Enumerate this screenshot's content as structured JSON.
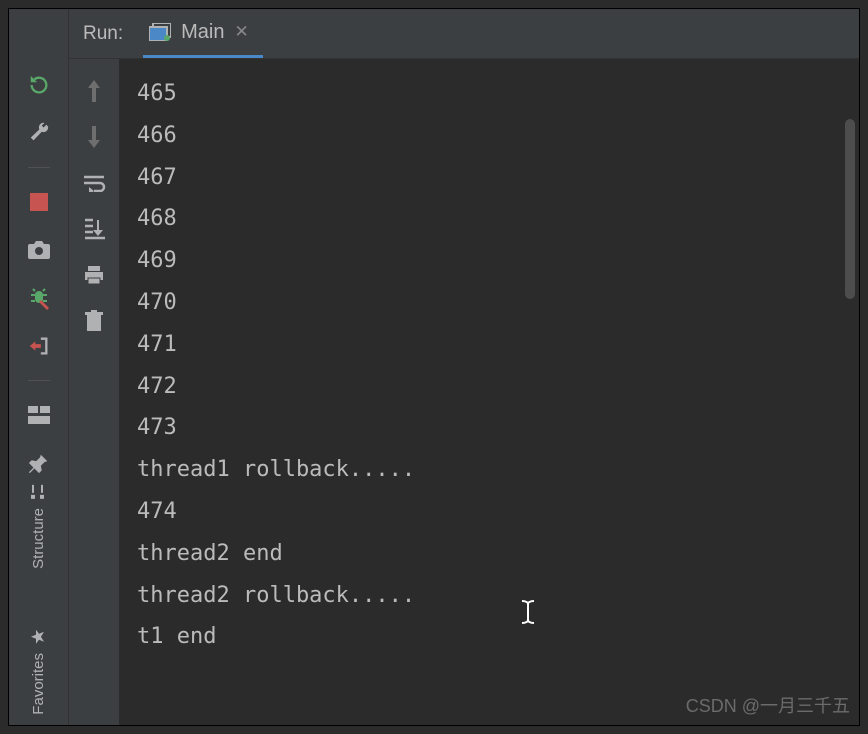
{
  "header": {
    "run_label": "Run:",
    "tab_name": "Main"
  },
  "left_rail_tabs": {
    "structure": "Structure",
    "favorites": "Favorites"
  },
  "console_lines": [
    "465",
    "466",
    "467",
    "468",
    "469",
    "470",
    "471",
    "472",
    "473",
    "thread1 rollback.....",
    "474",
    "thread2 end",
    "thread2 rollback.....",
    "t1 end"
  ],
  "watermark": "CSDN @一月三千五"
}
